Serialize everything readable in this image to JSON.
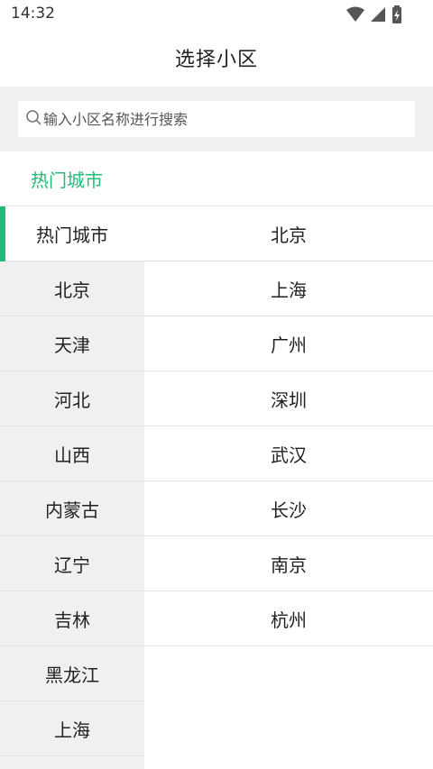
{
  "status_bar": {
    "time": "14:32",
    "icons": [
      "wifi-icon",
      "signal-icon",
      "battery-charging-icon"
    ]
  },
  "header": {
    "title": "选择小区"
  },
  "search": {
    "placeholder": "输入小区名称进行搜索",
    "value": "",
    "icon": "search-icon"
  },
  "section": {
    "title": "热门城市"
  },
  "accent_color": "#22bb77",
  "provinces": [
    {
      "label": "热门城市",
      "selected": true
    },
    {
      "label": "北京",
      "selected": false
    },
    {
      "label": "天津",
      "selected": false
    },
    {
      "label": "河北",
      "selected": false
    },
    {
      "label": "山西",
      "selected": false
    },
    {
      "label": "内蒙古",
      "selected": false
    },
    {
      "label": "辽宁",
      "selected": false
    },
    {
      "label": "吉林",
      "selected": false
    },
    {
      "label": "黑龙江",
      "selected": false
    },
    {
      "label": "上海",
      "selected": false
    }
  ],
  "cities": [
    {
      "label": "北京"
    },
    {
      "label": "上海"
    },
    {
      "label": "广州"
    },
    {
      "label": "深圳"
    },
    {
      "label": "武汉"
    },
    {
      "label": "长沙"
    },
    {
      "label": "南京"
    },
    {
      "label": "杭州"
    }
  ]
}
